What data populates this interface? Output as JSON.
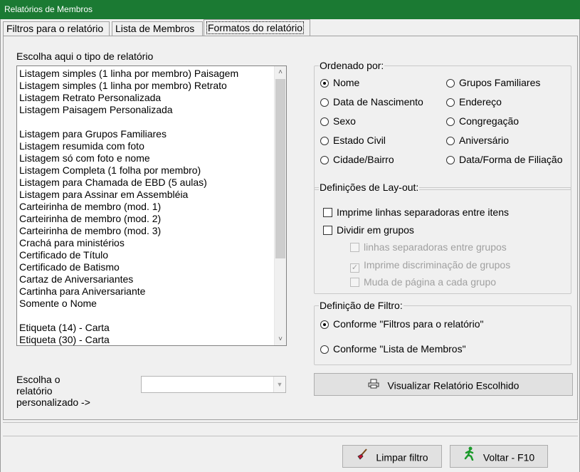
{
  "window": {
    "title": "Relatórios de Membros"
  },
  "tabs": [
    {
      "label": "Filtros para o relatório"
    },
    {
      "label": "Lista de Membros"
    },
    {
      "label": "Formatos do relatório"
    }
  ],
  "report_type": {
    "label": "Escolha aqui o tipo de relatório",
    "items": [
      "Listagem simples (1 linha por membro) Paisagem",
      "Listagem simples (1 linha por membro) Retrato",
      "Listagem Retrato Personalizada",
      "Listagem Paisagem Personalizada",
      "",
      "Listagem para Grupos Familiares",
      "Listagem resumida com foto",
      "Listagem só com foto e nome",
      "Listagem Completa (1 folha por membro)",
      "Listagem para Chamada de EBD (5 aulas)",
      "Listagem para Assinar em Assembléia",
      "Carteirinha de membro (mod. 1)",
      "Carteirinha de membro (mod. 2)",
      "Carteirinha de membro (mod. 3)",
      "Crachá para ministérios",
      "Certificado de Título",
      "Certificado de Batismo",
      "Cartaz de Aniversariantes",
      "Cartinha para Aniversariante",
      "Somente o Nome",
      "",
      "Etiqueta (14) - Carta",
      "Etiqueta (30) - Carta"
    ]
  },
  "custom_report": {
    "label_line1": "Escolha o",
    "label_line2": "relatório",
    "label_line3": "personalizado ->",
    "value": ""
  },
  "order_by": {
    "legend": "Ordenado por:",
    "selected": "Nome",
    "options": [
      "Nome",
      "Data de Nascimento",
      "Sexo",
      "Estado Civil",
      "Cidade/Bairro",
      "Grupos Familiares",
      "Endereço",
      "Congregação",
      "Aniversário",
      "Data/Forma de Filiação"
    ]
  },
  "layout": {
    "legend": "Definições de Lay-out:",
    "print_separator_lines": "Imprime linhas separadoras entre itens",
    "divide_in_groups": "Dividir em grupos",
    "group_separator_lines": "linhas separadoras entre grupos",
    "print_group_breakdown": "Imprime discriminação de grupos",
    "page_break_per_group": "Muda de página a cada grupo"
  },
  "filter_def": {
    "legend": "Definição de Filtro:",
    "option_filters": "Conforme \"Filtros para o relatório\"",
    "option_members": "Conforme \"Lista de Membros\""
  },
  "buttons": {
    "preview": "Visualizar Relatório Escolhido",
    "clear_filter": "Limpar filtro",
    "back": "Voltar - F10"
  },
  "colors": {
    "titlebar": "#1b7a33",
    "panel": "#f0f0f0",
    "button": "#e1e1e1"
  },
  "icons": {
    "preview": "printer-icon",
    "clear_filter": "broom-icon",
    "back": "running-man-icon"
  }
}
